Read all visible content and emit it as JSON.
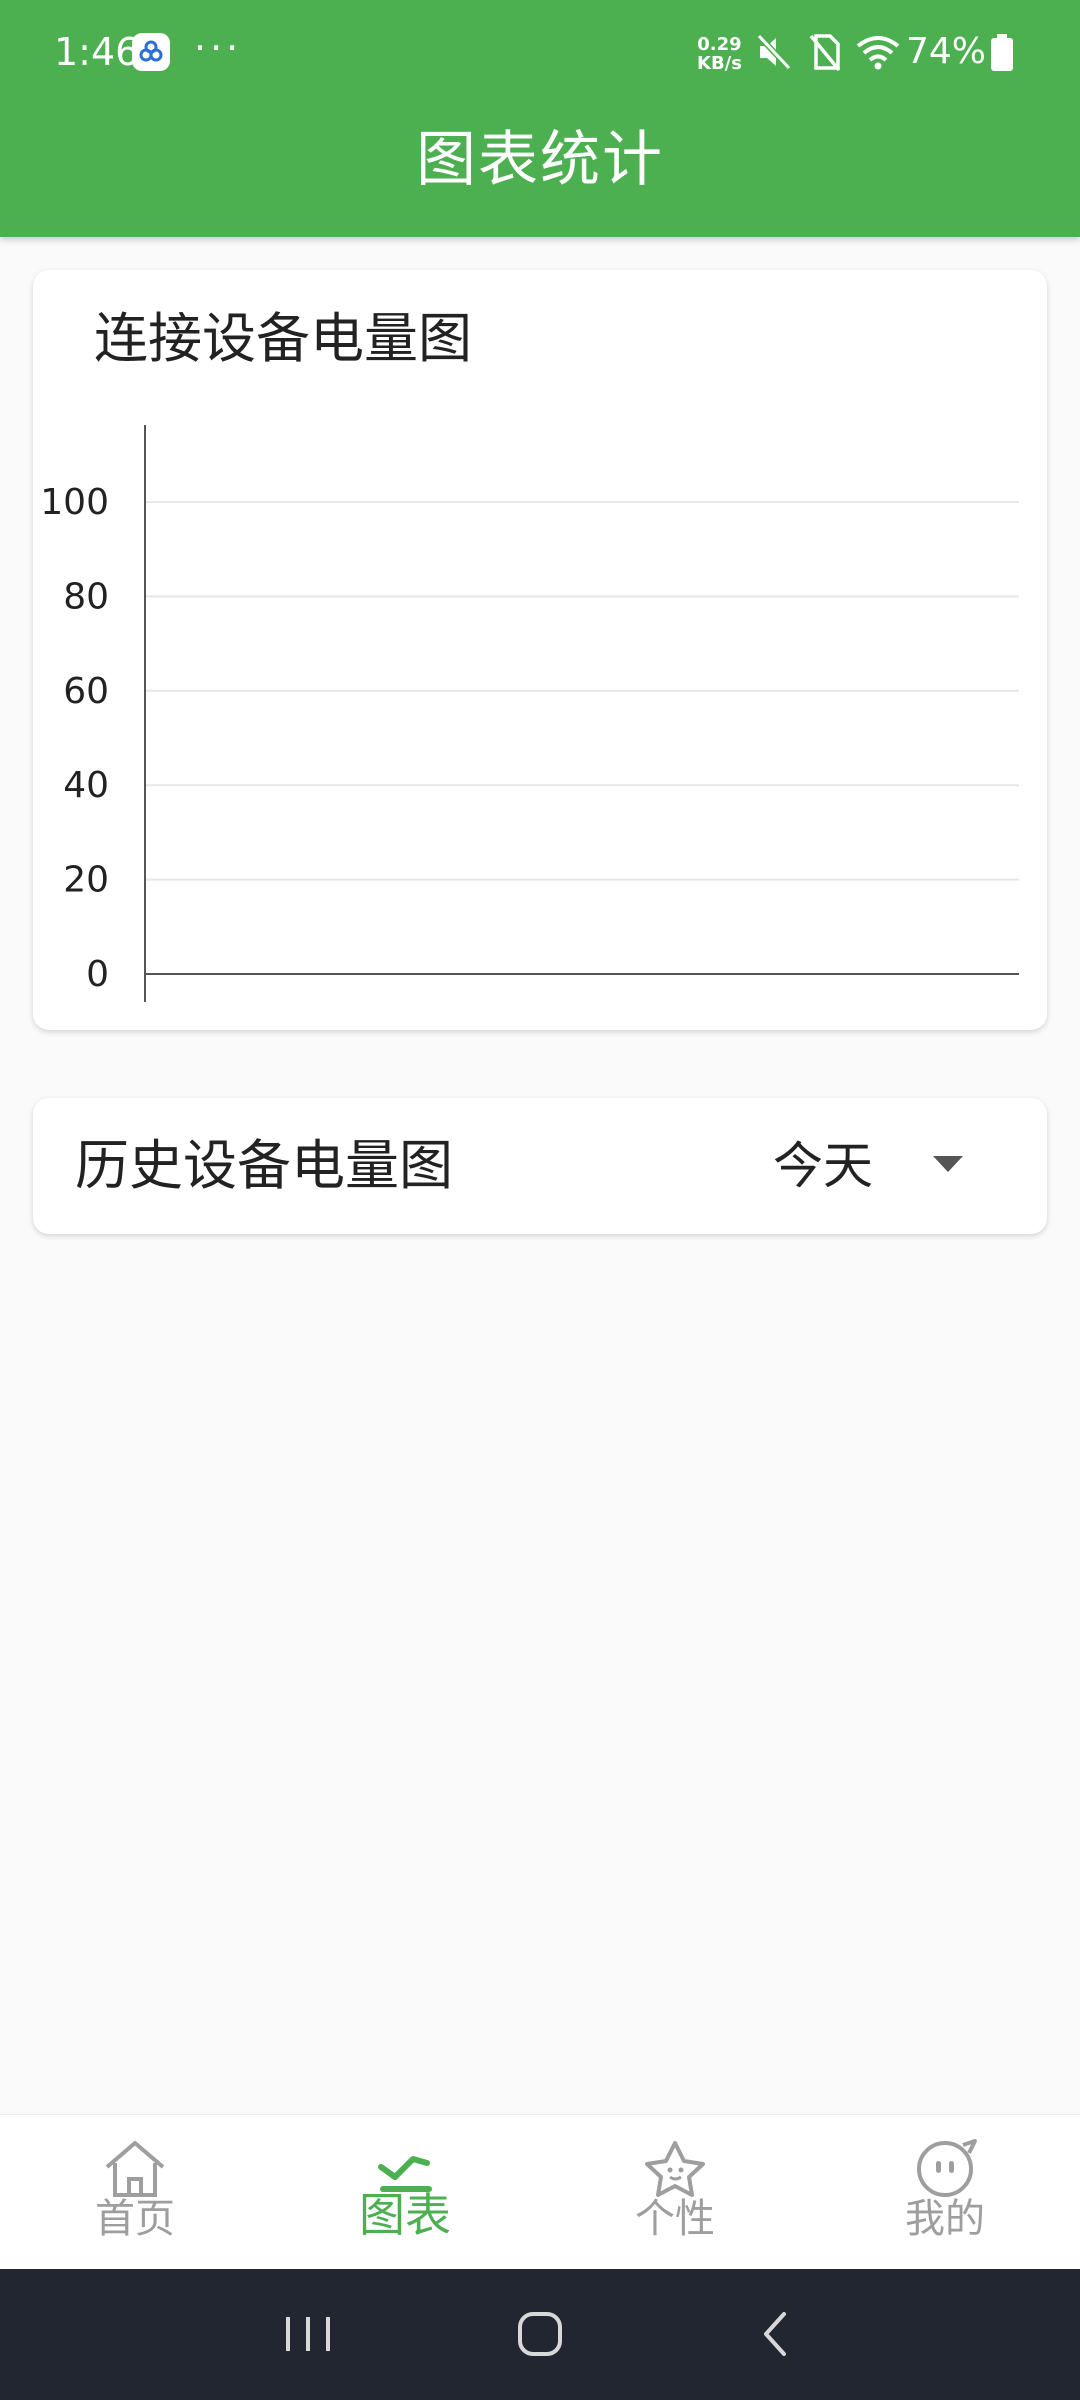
{
  "status_bar": {
    "time": "1:46",
    "more": "···",
    "net_speed_value": "0.29",
    "net_speed_unit": "KB/s",
    "battery": "74%"
  },
  "header": {
    "title": "图表统计"
  },
  "connected_card": {
    "title": "连接设备电量图",
    "chart_data": {
      "type": "line",
      "title": "连接设备电量图",
      "x": [],
      "series": [],
      "ylim": [
        0,
        100
      ],
      "yticks": [
        0,
        20,
        40,
        60,
        80,
        100
      ],
      "ytick_labels": [
        "0",
        "20",
        "40",
        "60",
        "80",
        "100"
      ],
      "grid": true,
      "legend": "none"
    }
  },
  "history_card": {
    "title": "历史设备电量图",
    "range_selected": "今天"
  },
  "bottom_nav": {
    "items": [
      {
        "label": "首页",
        "icon": "home-icon"
      },
      {
        "label": "图表",
        "icon": "chart-icon"
      },
      {
        "label": "个性",
        "icon": "star-icon"
      },
      {
        "label": "我的",
        "icon": "profile-icon"
      }
    ],
    "active_index": 1
  },
  "colors": {
    "primary": "#4caf50",
    "inactive": "#9e9e9e",
    "system_nav": "#212631"
  }
}
